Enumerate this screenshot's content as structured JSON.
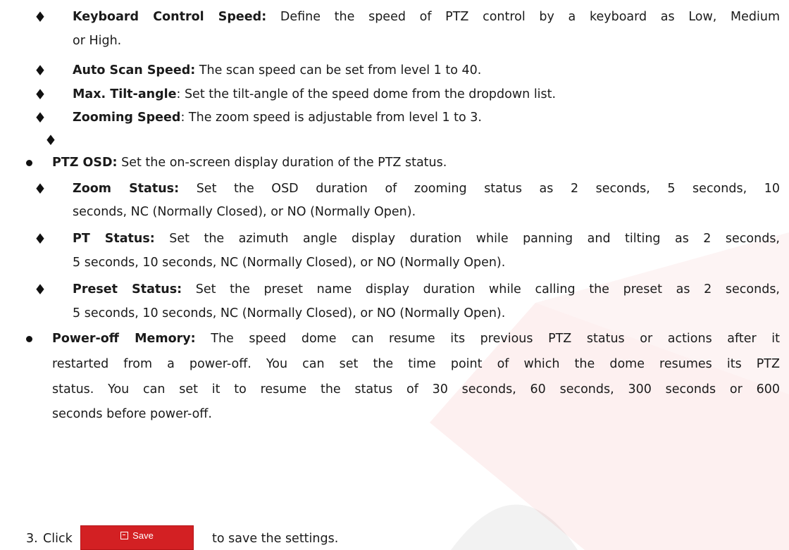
{
  "bullets": {
    "diamond": "♦"
  },
  "items": {
    "keyboard": {
      "term": "Keyboard Control Speed:",
      "desc_line1": " Define the speed of PTZ control by a keyboard as Low, Medium",
      "desc_line2": "or High."
    },
    "autoscan": {
      "term": "Auto Scan Speed:",
      "desc": " The scan speed can be set from level 1 to 40."
    },
    "tilt": {
      "term": "Max. Tilt-angle",
      "desc": ": Set the tilt-angle of the speed dome from the dropdown list."
    },
    "zooming": {
      "term": "Zooming Speed",
      "desc": ": The zoom speed is adjustable from level 1 to 3."
    },
    "ptz_osd": {
      "term": "PTZ OSD:",
      "desc": " Set the on-screen display duration of the PTZ status."
    },
    "zoom_status": {
      "term": "Zoom Status:",
      "desc_line1": " Set the OSD duration of zooming status as 2 seconds, 5 seconds, 10",
      "desc_line2": "seconds, NC (Normally Closed), or NO (Normally Open)."
    },
    "pt_status": {
      "term": "PT Status:",
      "desc_line1": " Set the azimuth angle display duration while panning and tilting as 2 seconds,",
      "desc_line2": "5 seconds, 10 seconds, NC (Normally Closed), or NO (Normally Open)."
    },
    "preset_status": {
      "term": "Preset Status:",
      "desc_line1": " Set the preset name display duration while calling the preset as 2 seconds,",
      "desc_line2": "5 seconds, 10 seconds, NC (Normally Closed), or NO (Normally Open)."
    },
    "power_off": {
      "term": "Power-off Memory:",
      "desc_line1": " The speed dome can resume its previous PTZ status or actions after it",
      "desc_line2": "restarted from a power-off. You can set the time point of which the dome resumes its PTZ",
      "desc_line3": "status. You can set it to resume the status of 30 seconds, 60 seconds, 300 seconds or 600",
      "desc_line4": "seconds before power-off."
    }
  },
  "step3": {
    "number": "3.",
    "click": "Click",
    "button_label": "Save",
    "suffix": "to save the settings."
  },
  "colors": {
    "save_button": "#d32023",
    "watermark": "#e02a2a"
  },
  "icons": {
    "save": "floppy-disk-icon"
  }
}
